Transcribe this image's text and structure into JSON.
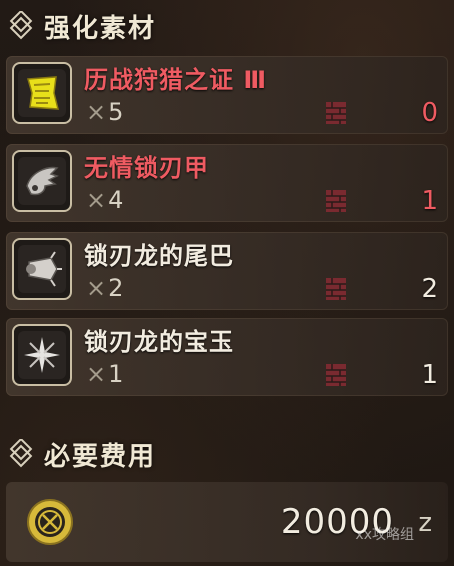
{
  "materials_section": {
    "title": "强化素材"
  },
  "items": [
    {
      "name": "历战狩猎之证 Ⅲ",
      "qty_prefix": "×",
      "qty": "5",
      "owned": "0",
      "name_color": "red",
      "owned_color": "red",
      "icon": "hunter-ticket-icon"
    },
    {
      "name": "无情锁刃甲",
      "qty_prefix": "×",
      "qty": "4",
      "owned": "1",
      "name_color": "red",
      "owned_color": "red",
      "icon": "blade-shell-icon"
    },
    {
      "name": "锁刃龙的尾巴",
      "qty_prefix": "×",
      "qty": "2",
      "owned": "2",
      "name_color": "white",
      "owned_color": "white",
      "icon": "tail-icon"
    },
    {
      "name": "锁刃龙的宝玉",
      "qty_prefix": "×",
      "qty": "1",
      "owned": "1",
      "name_color": "white",
      "owned_color": "white",
      "icon": "gem-icon"
    }
  ],
  "cost_section": {
    "title": "必要费用"
  },
  "cost": {
    "value": "20000",
    "unit": "z",
    "icon": "zenny-coin-icon",
    "watermark": "xx攻略组"
  },
  "colors": {
    "shortage": "#ef5b62",
    "normal": "#f2ece0",
    "accent_gold": "#d7b93a"
  }
}
